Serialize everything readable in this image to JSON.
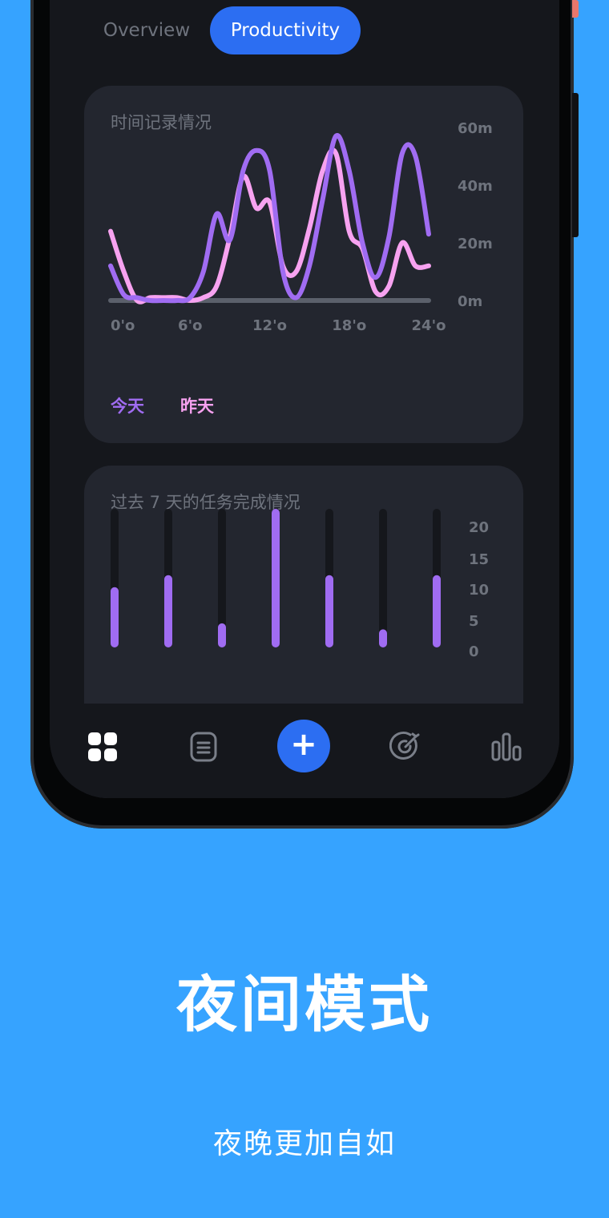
{
  "tabs": [
    {
      "label": "Overview",
      "active": false
    },
    {
      "label": "Productivity",
      "active": true
    }
  ],
  "time_card": {
    "title": "时间记录情况",
    "legend": {
      "today": "今天",
      "yesterday": "昨天"
    },
    "chart_data": {
      "type": "line",
      "x_ticks": [
        "0'o",
        "6'o",
        "12'o",
        "18'o",
        "24'o"
      ],
      "y_ticks": [
        "0m",
        "20m",
        "40m",
        "60m"
      ],
      "ylim": [
        0,
        60
      ],
      "xlim": [
        0,
        24
      ],
      "series": [
        {
          "name": "今天",
          "color": "#A06CF2",
          "x": [
            0,
            1,
            2,
            3,
            4,
            5,
            6,
            7,
            8,
            9,
            10,
            11,
            12,
            13,
            14,
            15,
            16,
            17,
            18,
            19,
            20,
            21,
            22,
            23,
            24
          ],
          "y": [
            12,
            2,
            1,
            0,
            0,
            0,
            1,
            10,
            30,
            21,
            45,
            52,
            45,
            10,
            1,
            12,
            35,
            57,
            45,
            20,
            8,
            22,
            51,
            50,
            23
          ]
        },
        {
          "name": "昨天",
          "color": "#F7A2F0",
          "x": [
            0,
            1,
            2,
            3,
            4,
            5,
            6,
            7,
            8,
            9,
            10,
            11,
            12,
            13,
            14,
            15,
            16,
            17,
            18,
            19,
            20,
            21,
            22,
            23,
            24
          ],
          "y": [
            24,
            10,
            0,
            1,
            1,
            1,
            0,
            1,
            5,
            22,
            43,
            32,
            34,
            12,
            10,
            25,
            45,
            51,
            24,
            18,
            3,
            5,
            20,
            12,
            12
          ]
        }
      ]
    }
  },
  "task_card": {
    "title": "过去 7 天的任务完成情况",
    "chart_data": {
      "type": "bar",
      "y_ticks": [
        "20",
        "15",
        "10",
        "5",
        "0"
      ],
      "ylim": [
        0,
        23
      ],
      "values": [
        10,
        12,
        4,
        23,
        12,
        3,
        12
      ]
    }
  },
  "nav": {
    "items": [
      "dashboard-icon",
      "notes-icon",
      "add-button",
      "goal-icon",
      "stats-icon"
    ],
    "add_label": "+"
  },
  "headline": "夜间模式",
  "subtitle": "夜晚更加自如",
  "colors": {
    "background": "#36A3FF",
    "accent": "#2C6EF2",
    "today": "#A06CF2",
    "yesterday": "#F7A2F0"
  }
}
